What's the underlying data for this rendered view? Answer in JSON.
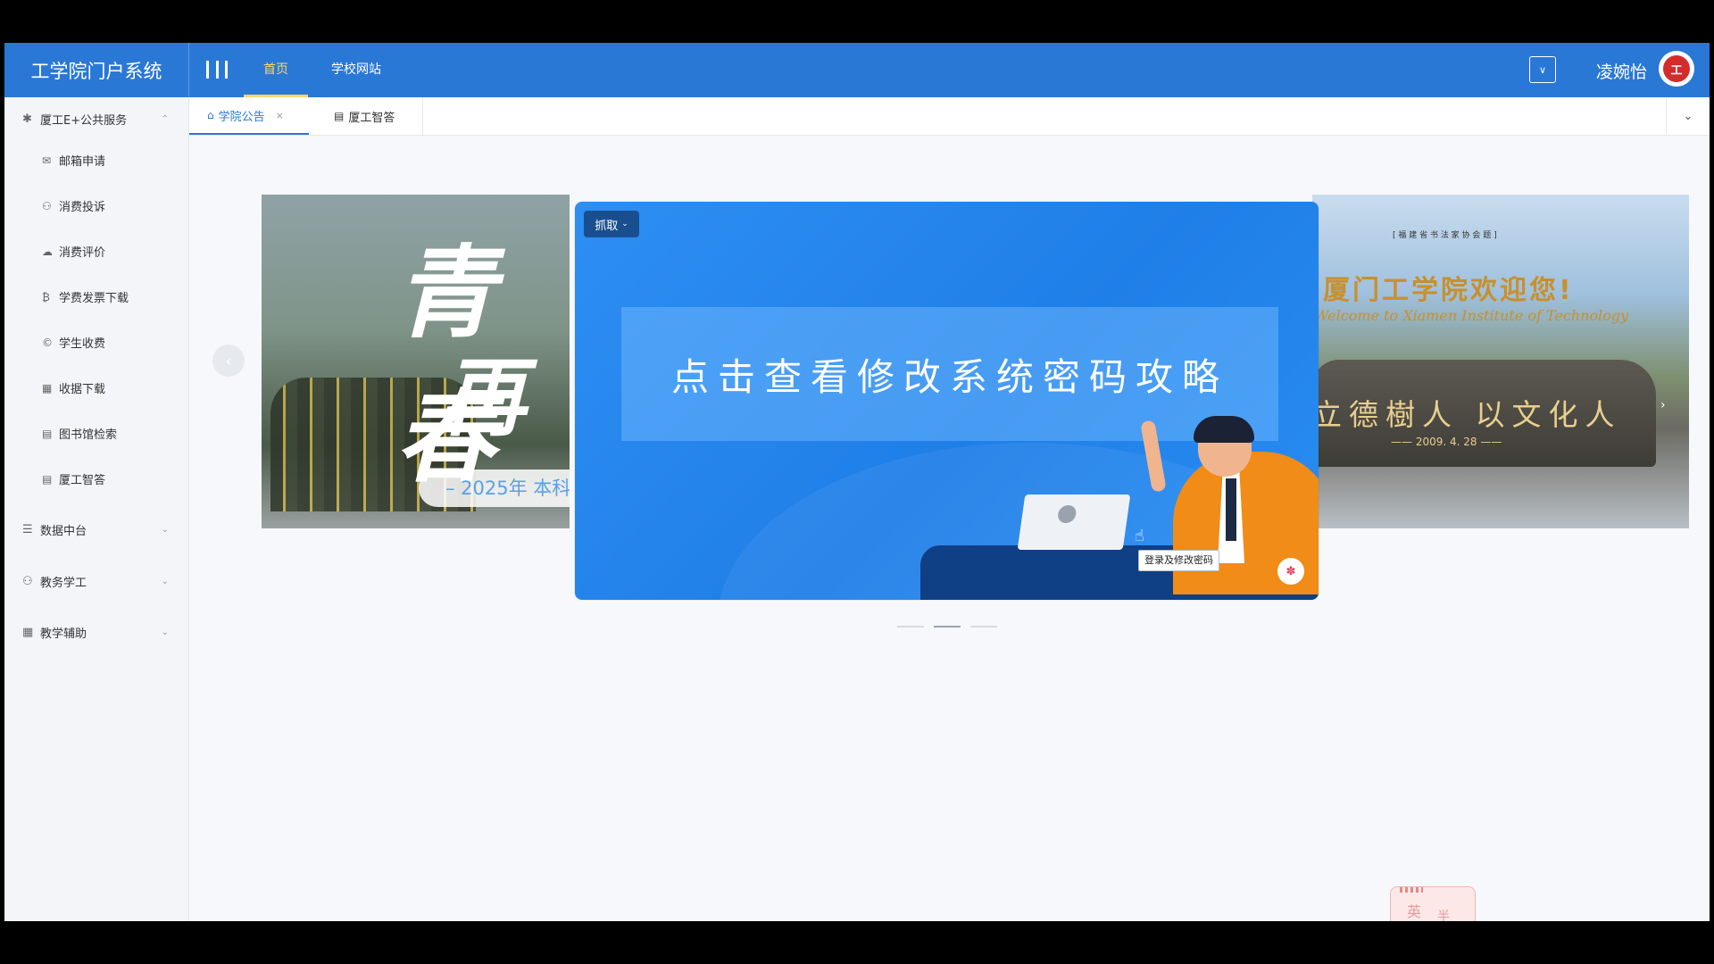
{
  "header": {
    "app_title": "工学院门户系统",
    "nav": [
      {
        "label": "首页",
        "active": true
      },
      {
        "label": "学校网站",
        "active": false
      }
    ],
    "username": "凌婉怡"
  },
  "sidebar": {
    "groups": [
      {
        "label": "厦工E+公共服务",
        "icon": "gear-icon",
        "expanded": true,
        "items": [
          {
            "label": "邮箱申请",
            "icon": "mail-icon"
          },
          {
            "label": "消费投诉",
            "icon": "users-icon"
          },
          {
            "label": "消费评价",
            "icon": "cloud-icon"
          },
          {
            "label": "学费发票下载",
            "icon": "bitcoin-icon"
          },
          {
            "label": "学生收费",
            "icon": "copyright-icon"
          },
          {
            "label": "收据下载",
            "icon": "calculator-icon"
          },
          {
            "label": "图书馆检索",
            "icon": "book-icon"
          },
          {
            "label": "厦工智答",
            "icon": "book-icon"
          }
        ]
      },
      {
        "label": "数据中台",
        "icon": "database-icon",
        "expanded": false
      },
      {
        "label": "教务学工",
        "icon": "users-icon",
        "expanded": false
      },
      {
        "label": "教学辅助",
        "icon": "building-icon",
        "expanded": false
      }
    ]
  },
  "tabs": [
    {
      "label": "学院公告",
      "icon": "home-icon",
      "active": true,
      "closable": true
    },
    {
      "label": "厦工智答",
      "icon": "book-icon",
      "active": false,
      "closable": false
    }
  ],
  "carousel": {
    "left_slide": {
      "big_text_1": "青春",
      "big_text_2": "再",
      "pill_text": "– 2025年 本科"
    },
    "right_slide": {
      "small_caption": "[ 福 建 省 书 法 家 协 会 题 ]",
      "welcome": "厦门工学院欢迎您!",
      "welcome_en": "Welcome to Xiamen Institute of Technology",
      "motto": "立德樹人 以文化人",
      "motto_date": "—— 2009. 4. 28 ——"
    },
    "prev_icon": "chevron-left-icon",
    "next_icon": "chevron-right-icon"
  },
  "banner": {
    "grab_button": "抓取",
    "headline": "点击查看修改系统密码攻略",
    "tooltip": "登录及修改密码"
  },
  "widget": {
    "char1": "英",
    "char2": "半"
  },
  "colors": {
    "primary": "#2a78d6",
    "nav_active": "#ffd76a",
    "banner_bg": "#1f7fe8"
  }
}
